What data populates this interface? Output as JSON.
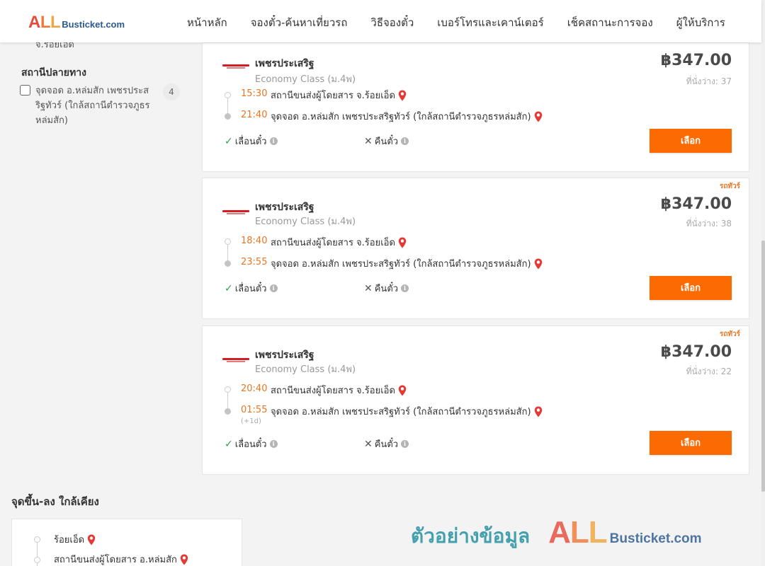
{
  "header": {
    "logo_all_1": "A",
    "logo_all_2": "L",
    "logo_all_3": "L",
    "logo_rest": "Busticket.com",
    "nav": [
      "หน้าหลัก",
      "จองตั๋ว-ค้นหาเที่ยวรถ",
      "วิธีจองตั๋ว",
      "เบอร์โทรและเคาน์เตอร์",
      "เช็คสถานะการจอง",
      "ผู้ให้บริการ"
    ]
  },
  "sidebar": {
    "cut_text": "จ.ร้อยเอ็ด",
    "destination_title": "สถานีปลายทาง",
    "options": [
      {
        "label": "จุดจอด อ.หล่มสัก เพชรประสริฐทัวร์ (ใกล้สถานีตำรวจภูธรหล่มสัก)",
        "count": "4"
      }
    ]
  },
  "trips": [
    {
      "badge": "",
      "operator": "เพชรประเสริฐ",
      "class": "Economy Class (ม.4พ)",
      "price": "฿347.00",
      "seats": "ที่นั่งว่าง: 37",
      "depart_time": "15:30",
      "depart_stop": "สถานีขนส่งผู้โดยสาร จ.ร้อยเอ็ด",
      "arrive_time": "21:40",
      "arrive_stop": "จุดจอด อ.หล่มสัก เพชรประสริฐทัวร์ (ใกล้สถานีตำรวจภูธรหล่มสัก)",
      "plus_day": "",
      "reschedule": "เลื่อนตั๋ว",
      "refund": "คืนตั๋ว",
      "select_label": "เลือก"
    },
    {
      "badge": "รถทัวร์",
      "operator": "เพชรประเสริฐ",
      "class": "Economy Class (ม.4พ)",
      "price": "฿347.00",
      "seats": "ที่นั่งว่าง: 38",
      "depart_time": "18:40",
      "depart_stop": "สถานีขนส่งผู้โดยสาร จ.ร้อยเอ็ด",
      "arrive_time": "23:55",
      "arrive_stop": "จุดจอด อ.หล่มสัก เพชรประสริฐทัวร์ (ใกล้สถานีตำรวจภูธรหล่มสัก)",
      "plus_day": "",
      "reschedule": "เลื่อนตั๋ว",
      "refund": "คืนตั๋ว",
      "select_label": "เลือก"
    },
    {
      "badge": "รถทัวร์",
      "operator": "เพชรประเสริฐ",
      "class": "Economy Class (ม.4พ)",
      "price": "฿347.00",
      "seats": "ที่นั่งว่าง: 22",
      "depart_time": "20:40",
      "depart_stop": "สถานีขนส่งผู้โดยสาร จ.ร้อยเอ็ด",
      "arrive_time": "01:55",
      "arrive_stop": "จุดจอด อ.หล่มสัก เพชรประสริฐทัวร์ (ใกล้สถานีตำรวจภูธรหล่มสัก)",
      "plus_day": "(+1d)",
      "reschedule": "เลื่อนตั๋ว",
      "refund": "คืนตั๋ว",
      "select_label": "เลือก"
    }
  ],
  "nearby": {
    "title": "จุดขึ้น-ลง ใกล้เคียง",
    "items": [
      "ร้อยเอ็ด",
      "สถานีขนส่งผู้โดยสาร อ.หล่มสัก"
    ]
  },
  "watermark": {
    "thai": "ตัวอย่างข้อมูล",
    "all_1": "A",
    "all_2": "L",
    "all_3": "L",
    "rest": "Busticket.com"
  },
  "colors": {
    "accent_orange": "#fc6a02",
    "time_orange": "#e87722",
    "pin_red": "#e53935",
    "check_green": "#2e9e44"
  },
  "icons": {
    "pin": "map-pin-icon",
    "check": "check-icon",
    "cross": "cross-icon",
    "info": "info-icon"
  }
}
